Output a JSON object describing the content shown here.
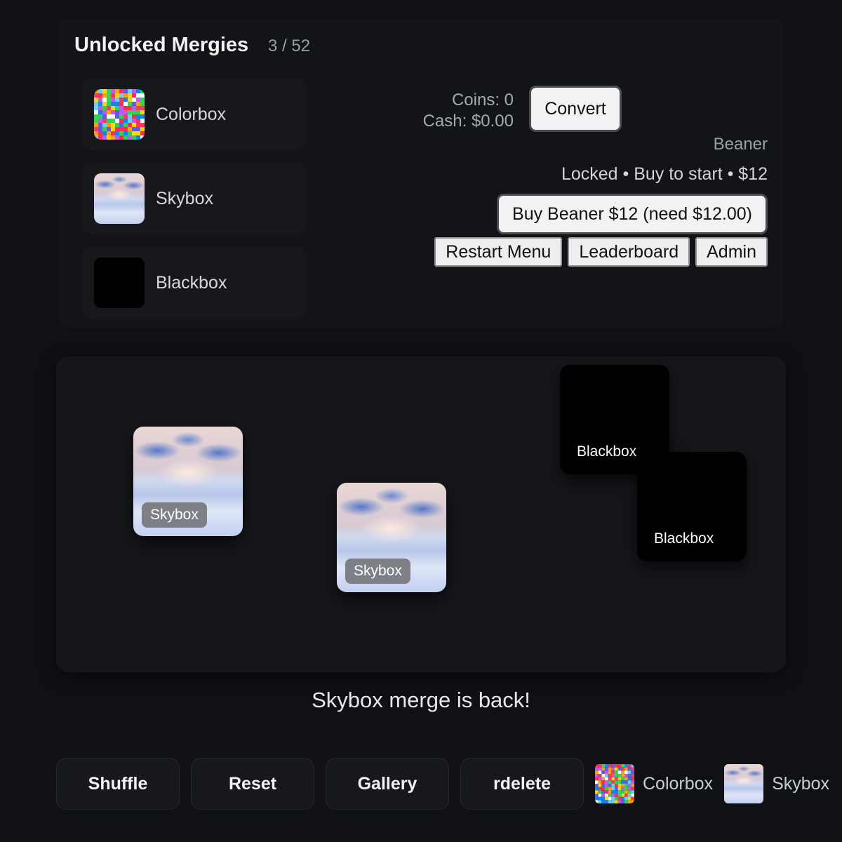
{
  "unlocked": {
    "title": "Unlocked Mergies",
    "count": "3 / 52",
    "items": [
      {
        "label": "Colorbox",
        "icon": "colorbox-thumbnail"
      },
      {
        "label": "Skybox",
        "icon": "skybox-thumbnail"
      },
      {
        "label": "Blackbox",
        "icon": "blackbox-thumbnail"
      }
    ]
  },
  "wallet": {
    "coins": "Coins: 0",
    "cash": "Cash: $0.00",
    "convert_label": "Convert"
  },
  "next_merge": {
    "name": "Beaner",
    "status": "Locked • Buy to start • $12",
    "buy_label": "Buy Beaner $12 (need $12.00)"
  },
  "menu": {
    "restart_label": "Restart Menu",
    "leaderboard_label": "Leaderboard",
    "admin_label": "Admin"
  },
  "board": {
    "tiles": [
      {
        "label": "Skybox",
        "kind": "skybox"
      },
      {
        "label": "Skybox",
        "kind": "skybox"
      },
      {
        "label": "Blackbox",
        "kind": "blackbox"
      },
      {
        "label": "Blackbox",
        "kind": "blackbox"
      }
    ]
  },
  "message": "Skybox merge is back!",
  "actions": {
    "shuffle_label": "Shuffle",
    "reset_label": "Reset",
    "gallery_label": "Gallery",
    "rdelete_label": "rdelete"
  },
  "spawn": [
    {
      "label": "Colorbox"
    },
    {
      "label": "Skybox"
    }
  ],
  "colors": {
    "background": "#0f1114",
    "panel": "#121417",
    "button_light": "#f2f2f2",
    "muted_text": "#9aa0a6"
  }
}
